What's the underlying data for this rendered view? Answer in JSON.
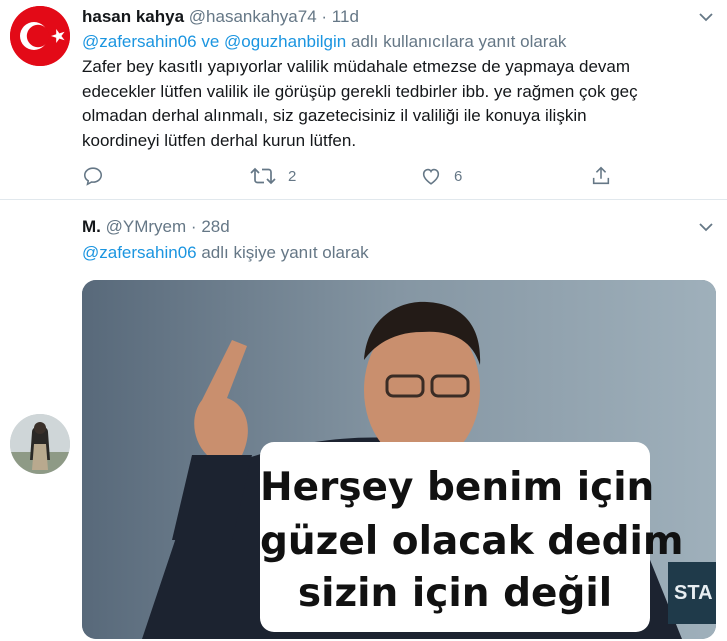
{
  "tweets": [
    {
      "name": "hasan kahya",
      "handle": "@hasankahya74",
      "separator": "·",
      "time": "11d",
      "reply_mention_1": "@zafersahin06",
      "reply_joiner": "ve",
      "reply_mention_2": "@oguzhanbilgin",
      "reply_suffix": "adlı kullanıcılara yanıt olarak",
      "text_lines": [
        "Zafer bey kasıtlı yapıyorlar valilik müdahale etmezse de yapmaya devam",
        "edecekler lütfen valilik ile görüşüp gerekli tedbirler ibb. ye rağmen çok geç",
        "olmadan derhal alınmalı,  siz gazetecisiniz il valiliği ile konuya ilişkin",
        "koordineyi lütfen derhal kurun lütfen."
      ],
      "actions": {
        "reply_icon": "reply-icon",
        "retweet_icon": "retweet-icon",
        "retweet_count": "2",
        "like_icon": "heart-icon",
        "like_count": "6",
        "share_icon": "share-icon"
      }
    },
    {
      "name": "M.",
      "handle": "@YMryem",
      "separator": "·",
      "time": "28d",
      "reply_mention": "@zafersahin06",
      "reply_suffix": "adlı kişiye yanıt olarak",
      "media": {
        "caption_lines": [
          "Herşey benim için",
          "güzel olacak dedim",
          "sizin için değil"
        ],
        "sign_text": "STA"
      }
    }
  ],
  "colors": {
    "text": "#14171a",
    "secondary": "#657786",
    "link": "#1b95e0",
    "divider": "#e1e8ed"
  }
}
